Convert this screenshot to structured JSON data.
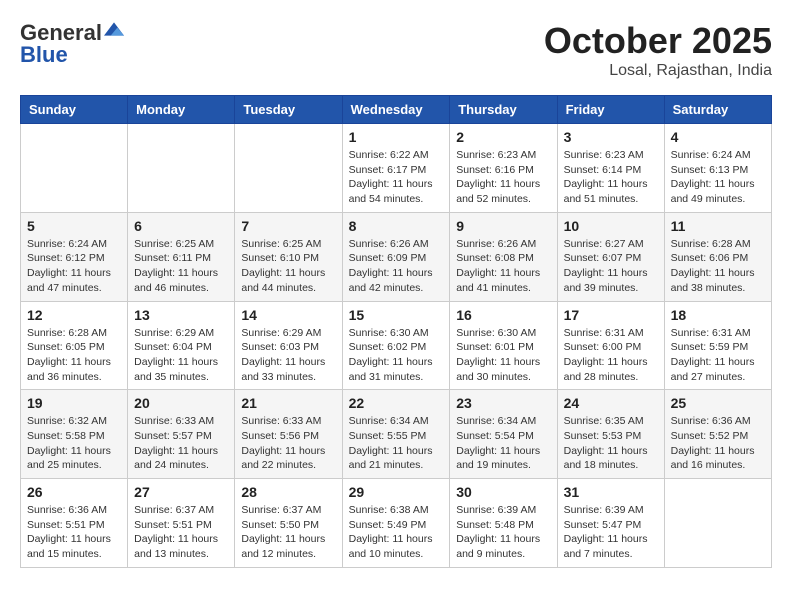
{
  "header": {
    "logo": {
      "line1": "General",
      "line2": "Blue"
    },
    "title": "October 2025",
    "subtitle": "Losal, Rajasthan, India"
  },
  "calendar": {
    "days_of_week": [
      "Sunday",
      "Monday",
      "Tuesday",
      "Wednesday",
      "Thursday",
      "Friday",
      "Saturday"
    ],
    "weeks": [
      [
        {
          "day": "",
          "info": ""
        },
        {
          "day": "",
          "info": ""
        },
        {
          "day": "",
          "info": ""
        },
        {
          "day": "1",
          "info": "Sunrise: 6:22 AM\nSunset: 6:17 PM\nDaylight: 11 hours and 54 minutes."
        },
        {
          "day": "2",
          "info": "Sunrise: 6:23 AM\nSunset: 6:16 PM\nDaylight: 11 hours and 52 minutes."
        },
        {
          "day": "3",
          "info": "Sunrise: 6:23 AM\nSunset: 6:14 PM\nDaylight: 11 hours and 51 minutes."
        },
        {
          "day": "4",
          "info": "Sunrise: 6:24 AM\nSunset: 6:13 PM\nDaylight: 11 hours and 49 minutes."
        }
      ],
      [
        {
          "day": "5",
          "info": "Sunrise: 6:24 AM\nSunset: 6:12 PM\nDaylight: 11 hours and 47 minutes."
        },
        {
          "day": "6",
          "info": "Sunrise: 6:25 AM\nSunset: 6:11 PM\nDaylight: 11 hours and 46 minutes."
        },
        {
          "day": "7",
          "info": "Sunrise: 6:25 AM\nSunset: 6:10 PM\nDaylight: 11 hours and 44 minutes."
        },
        {
          "day": "8",
          "info": "Sunrise: 6:26 AM\nSunset: 6:09 PM\nDaylight: 11 hours and 42 minutes."
        },
        {
          "day": "9",
          "info": "Sunrise: 6:26 AM\nSunset: 6:08 PM\nDaylight: 11 hours and 41 minutes."
        },
        {
          "day": "10",
          "info": "Sunrise: 6:27 AM\nSunset: 6:07 PM\nDaylight: 11 hours and 39 minutes."
        },
        {
          "day": "11",
          "info": "Sunrise: 6:28 AM\nSunset: 6:06 PM\nDaylight: 11 hours and 38 minutes."
        }
      ],
      [
        {
          "day": "12",
          "info": "Sunrise: 6:28 AM\nSunset: 6:05 PM\nDaylight: 11 hours and 36 minutes."
        },
        {
          "day": "13",
          "info": "Sunrise: 6:29 AM\nSunset: 6:04 PM\nDaylight: 11 hours and 35 minutes."
        },
        {
          "day": "14",
          "info": "Sunrise: 6:29 AM\nSunset: 6:03 PM\nDaylight: 11 hours and 33 minutes."
        },
        {
          "day": "15",
          "info": "Sunrise: 6:30 AM\nSunset: 6:02 PM\nDaylight: 11 hours and 31 minutes."
        },
        {
          "day": "16",
          "info": "Sunrise: 6:30 AM\nSunset: 6:01 PM\nDaylight: 11 hours and 30 minutes."
        },
        {
          "day": "17",
          "info": "Sunrise: 6:31 AM\nSunset: 6:00 PM\nDaylight: 11 hours and 28 minutes."
        },
        {
          "day": "18",
          "info": "Sunrise: 6:31 AM\nSunset: 5:59 PM\nDaylight: 11 hours and 27 minutes."
        }
      ],
      [
        {
          "day": "19",
          "info": "Sunrise: 6:32 AM\nSunset: 5:58 PM\nDaylight: 11 hours and 25 minutes."
        },
        {
          "day": "20",
          "info": "Sunrise: 6:33 AM\nSunset: 5:57 PM\nDaylight: 11 hours and 24 minutes."
        },
        {
          "day": "21",
          "info": "Sunrise: 6:33 AM\nSunset: 5:56 PM\nDaylight: 11 hours and 22 minutes."
        },
        {
          "day": "22",
          "info": "Sunrise: 6:34 AM\nSunset: 5:55 PM\nDaylight: 11 hours and 21 minutes."
        },
        {
          "day": "23",
          "info": "Sunrise: 6:34 AM\nSunset: 5:54 PM\nDaylight: 11 hours and 19 minutes."
        },
        {
          "day": "24",
          "info": "Sunrise: 6:35 AM\nSunset: 5:53 PM\nDaylight: 11 hours and 18 minutes."
        },
        {
          "day": "25",
          "info": "Sunrise: 6:36 AM\nSunset: 5:52 PM\nDaylight: 11 hours and 16 minutes."
        }
      ],
      [
        {
          "day": "26",
          "info": "Sunrise: 6:36 AM\nSunset: 5:51 PM\nDaylight: 11 hours and 15 minutes."
        },
        {
          "day": "27",
          "info": "Sunrise: 6:37 AM\nSunset: 5:51 PM\nDaylight: 11 hours and 13 minutes."
        },
        {
          "day": "28",
          "info": "Sunrise: 6:37 AM\nSunset: 5:50 PM\nDaylight: 11 hours and 12 minutes."
        },
        {
          "day": "29",
          "info": "Sunrise: 6:38 AM\nSunset: 5:49 PM\nDaylight: 11 hours and 10 minutes."
        },
        {
          "day": "30",
          "info": "Sunrise: 6:39 AM\nSunset: 5:48 PM\nDaylight: 11 hours and 9 minutes."
        },
        {
          "day": "31",
          "info": "Sunrise: 6:39 AM\nSunset: 5:47 PM\nDaylight: 11 hours and 7 minutes."
        },
        {
          "day": "",
          "info": ""
        }
      ]
    ]
  }
}
